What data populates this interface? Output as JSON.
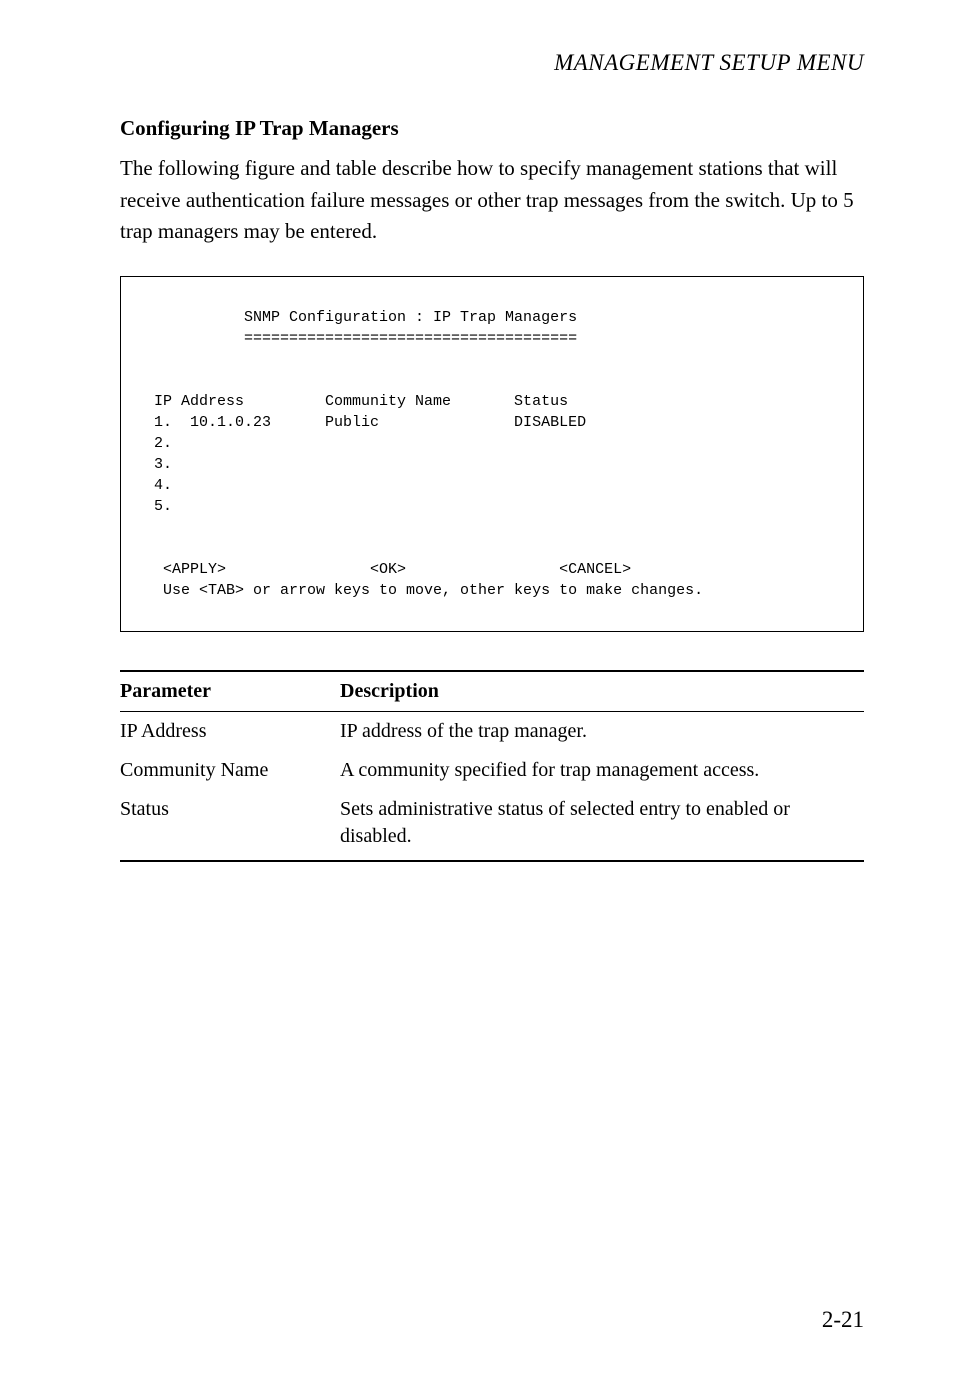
{
  "header": {
    "title": "MANAGEMENT SETUP MENU"
  },
  "section": {
    "heading": "Configuring IP Trap Managers",
    "intro": "The following figure and table describe how to specify management stations that will receive authentication failure messages or other trap messages from the switch. Up to 5 trap managers may be entered."
  },
  "terminal": {
    "title_line": "           SNMP Configuration : IP Trap Managers",
    "underline": "           =====================================",
    "col_headers": " IP Address         Community Name       Status",
    "row1": " 1.  10.1.0.23      Public               DISABLED",
    "row2": " 2.",
    "row3": " 3.",
    "row4": " 4.",
    "row5": " 5.",
    "buttons_line": "  <APPLY>                <OK>                 <CANCEL>",
    "hint_line": "  Use <TAB> or arrow keys to move, other keys to make changes."
  },
  "table": {
    "head_param": "Parameter",
    "head_desc": "Description",
    "rows": [
      {
        "param": "IP Address",
        "desc": "IP address of the trap manager."
      },
      {
        "param": "Community Name",
        "desc": "A community specified for trap management access."
      },
      {
        "param": "Status",
        "desc": "Sets administrative status of selected entry to enabled or disabled."
      }
    ]
  },
  "page_number": "2-21"
}
